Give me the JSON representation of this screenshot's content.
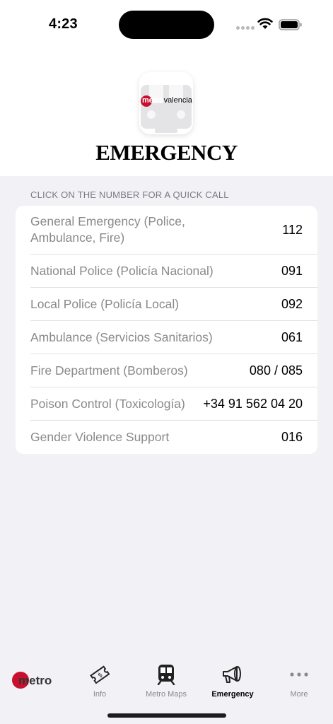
{
  "status_bar": {
    "time": "4:23",
    "icons": [
      "signal-dots-icon",
      "wifi-icon",
      "battery-icon"
    ]
  },
  "header": {
    "logo_text_bold": "metro",
    "logo_text_light": "valencia",
    "title": "EMERGENCY"
  },
  "section": {
    "label": "CLICK ON THE NUMBER FOR A QUICK CALL"
  },
  "contacts": [
    {
      "name": "General Emergency (Police, Ambulance, Fire)",
      "number": "112"
    },
    {
      "name": "National Police (Policía Nacional)",
      "number": "091"
    },
    {
      "name": "Local Police (Policía Local)",
      "number": "092"
    },
    {
      "name": "Ambulance (Servicios Sanitarios)",
      "number": "061"
    },
    {
      "name": "Fire Department (Bomberos)",
      "number": "080 / 085"
    },
    {
      "name": "Poison Control (Toxicología)",
      "number": "+34 91 562 04 20"
    },
    {
      "name": "Gender Violence Support",
      "number": "016"
    }
  ],
  "tab_bar": {
    "logo_text": "metro",
    "tabs": [
      {
        "label": "Info",
        "icon": "ticket-icon",
        "active": false
      },
      {
        "label": "Metro Maps",
        "icon": "train-icon",
        "active": false
      },
      {
        "label": "Emergency",
        "icon": "megaphone-icon",
        "active": true
      },
      {
        "label": "More",
        "icon": "more-icon",
        "active": false
      }
    ]
  },
  "colors": {
    "brand_red": "#c8102e",
    "background": "#f2f1f6",
    "secondary_text": "#8a8a8e"
  }
}
